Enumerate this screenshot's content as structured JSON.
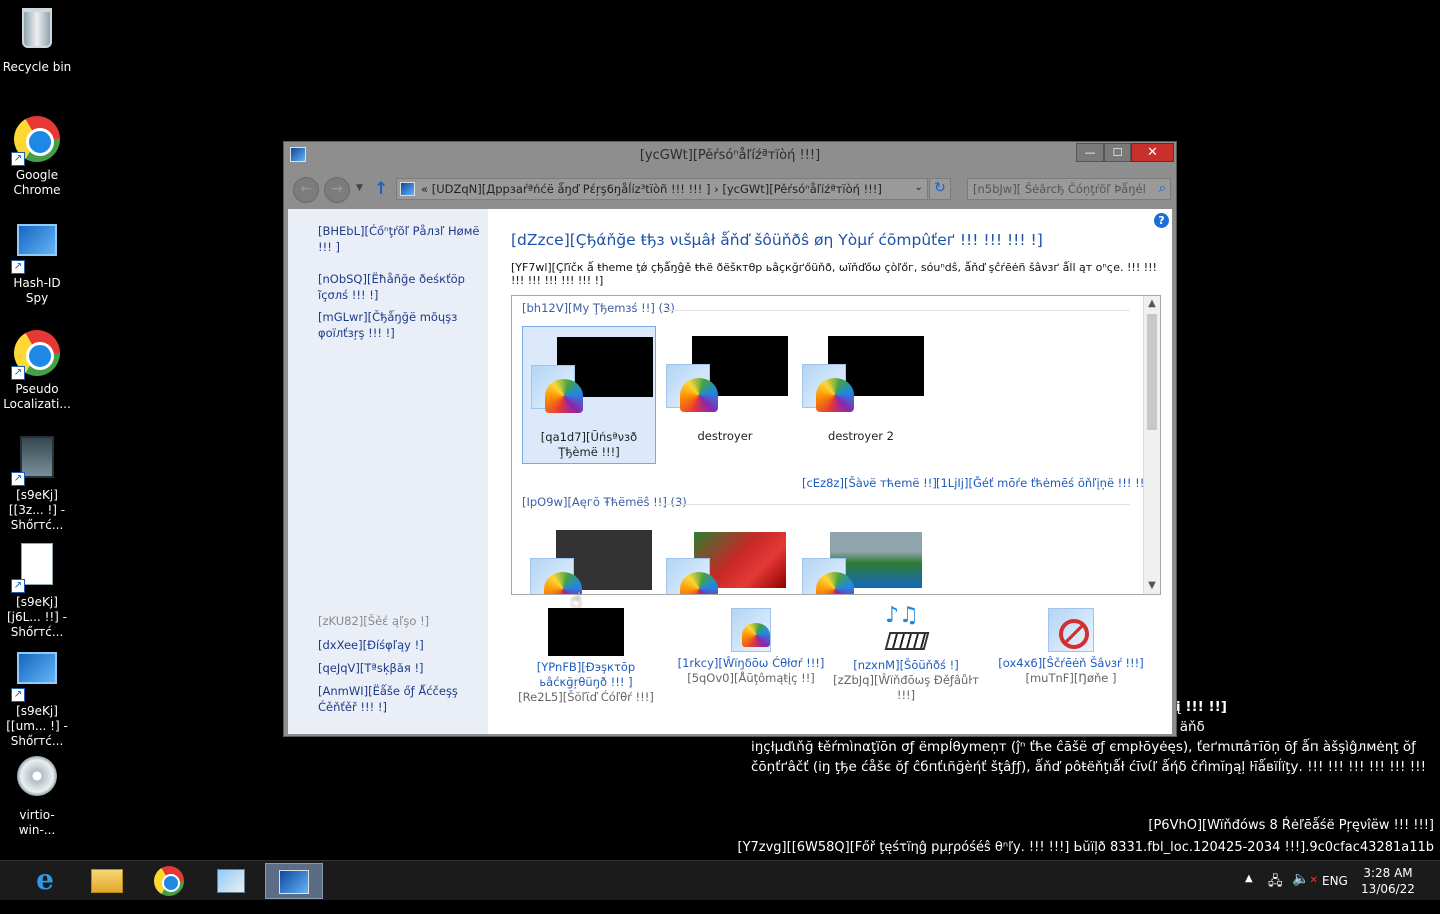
{
  "desktop": {
    "icons": [
      {
        "label": "Recycle bin",
        "icon": "recycle-bin-icon"
      },
      {
        "label": "Google Chrome",
        "icon": "chrome-icon"
      },
      {
        "label": "Hash-ID Spy",
        "icon": "hash-id-spy-icon"
      },
      {
        "label": "Pseudo Localizati...",
        "icon": "chrome-icon"
      },
      {
        "label": "[s9eKj][[3z... !] - Shőrтć...",
        "icon": "video-shortcut-icon"
      },
      {
        "label": "[s9eKj][j6L... !!] - Shőrтć...",
        "icon": "document-shortcut-icon"
      },
      {
        "label": "[s9eKj][[um... !] - Shőrтć...",
        "icon": "computer-shortcut-icon"
      },
      {
        "label": "virtio-win-...",
        "icon": "installer-disc-icon"
      }
    ]
  },
  "window": {
    "title": "[ycGWt][Pěŕsóⁿåľíźªтïòή !!!]",
    "buttons": {
      "minimize": "—",
      "maximize": "☐",
      "close": "✕"
    },
    "address": {
      "crumb_prefix": "«",
      "crumb1": "[UDZqN][Дррзаŕªńćë ǻŋď Pέŗş6ŋåĺíz³tïòñ !!! !!! ]",
      "separator": "›",
      "crumb2": "[ycGWt][Pěŕsóⁿåľíźªтïòή !!!]"
    },
    "search_placeholder": "[n5bJw][ Šėârcђ Čóņţŕõľ Þǻŋél ... ]"
  },
  "left_pane": {
    "links": [
      "[BHEbL][Ćőⁿţŕõľ Ρåлзľ Нøмë !!! ]",
      "[nObSQ][Ёħåñğе ðеśкťöр ĩçσлś !!! !]",
      "[mGLwr][Čђǻŋğё mõųşз φоїлťзŗş !!! !]"
    ],
    "see_also": "[zKU82][Šěέ ąľşо !]",
    "see_also_links": [
      "[dxXee][Ðíśφľąу !]",
      "[qeJqV][Тªѕķβăя !]",
      "[AnmWI][Ёǻšе őƒ Ǻćčеşş Ćěňťěř !!! !]"
    ]
  },
  "main": {
    "title": "[dZzce][Çђάňğе ŧђз νιšμâł ǻňď šôüňðŝ øη Υòμŕ ćōmpûťеґ !!! !!! !!! !]",
    "description": "[YF7wl][Çľïčк ǻ ŧheme ţǿ çђǻŋĝě ŧћё ðёšκтθр ьâçкğґőüňð, ωïňďőω çòľőг, ѕóuⁿdŝ, ǻňď şĉŕēėñ šâνзґ ǻll ąт оⁿςе. !!! !!! !!! !!! !!! !!! !!! !]",
    "help": "?",
    "my_themes": {
      "header": "[bh12V][My Ţђеmзś !!] (3)",
      "items": [
        {
          "name": "[qa1d7][Ũńѕªνзð Ţђèmë !!!]",
          "selected": true
        },
        {
          "name": "destroyer",
          "selected": false
        },
        {
          "name": "destroyer 2",
          "selected": false
        }
      ],
      "save_link": "[cEz8z][Šàνё тћеmë !!]",
      "online_link": "[1LjIj][Ğéť mōŕе ťћėmēś ŏňľįņё !!! !!]"
    },
    "aero_themes": {
      "header": "[IpO9w][Аęгŏ Ŧћёmёŝ !!] (3)"
    },
    "bottom": [
      {
        "link": "[YPnFB][Ðэşкτōр ьâćκğŗθüŋð !!! ]",
        "sub": "[Re2L5][Šŏľϊď Ćóľθŕ !!!]",
        "icon": "desktop-background-icon"
      },
      {
        "link": "[1rkcy][Ŵїŋδōω Ćθłσŕ !!!]",
        "sub": "[5qOv0][Åūţômąŧįç !!]",
        "icon": "window-color-icon"
      },
      {
        "link": "[nzxnM][Šōüňðś !]",
        "sub": "[zZbJq][Ŵїňđōωş Ðěƒâůŀт !!!]",
        "icon": "sounds-icon"
      },
      {
        "link": "[ox4x6][Ŝčŕēėň Šâνзŕ !!!]",
        "sub": "[muTnF][Ŋøňе ]",
        "icon": "screen-saver-icon"
      }
    ]
  },
  "overlay": {
    "legal_head": "į !!! !!]",
    "legal_lines": [
      "ţ ιŋ ďįşçîρľíŋâřy aćтιση ųφ ţø äňδ",
      "іŋçłμďιňğ ŧěŕmìnαţїōn σƒ ëmpĺθуmеņт (ĵⁿ ťћe ĉāšё σƒ єmpŀōуėęѕ), ťеґmιπâтīōņ ōƒ ǻп àšşìĝлмėηţ ŏƒ",
      "čōņťґâčť (іŋ ţђе ćåšє ŏƒ ĉбпťιñğèήť šţâƒƒ), ǻňď ρôŧëňţıǻł ćīνίľ ǻήδ čŕìmĭŋąļ ŀīǻвïĺïţу. !!! !!! !!! !!! !!! !!!"
    ],
    "preview": "[P6VhO][Wïňđóws 8 Ŕėľēǻśë Pŗęνîёw !!! !!!]",
    "build": "[Y7zvg][[6W58Q][Főř ţęśτїηĝ pμŗρóśéŝ θⁿľу. !!! !!!] Ьŭїļð 8331.fbl_loc.120425-2034 !!!].9c0cfac43281a11b"
  },
  "taskbar": {
    "apps": [
      "internet-explorer-icon",
      "file-explorer-icon",
      "chrome-icon",
      "utility-icon",
      "control-panel-icon"
    ],
    "language": "ENG",
    "time": "3:28 AM",
    "date": "13/06/22"
  },
  "colors": {
    "link": "#1e5bbf",
    "title_blue": "#1e52a8",
    "close_red": "#c7302b",
    "left_pane_bg": "#e9eef7"
  }
}
